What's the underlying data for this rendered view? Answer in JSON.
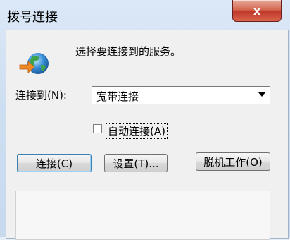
{
  "window": {
    "title": "拨号连接",
    "close_glyph": "x"
  },
  "header": {
    "prompt": "选择要连接到的服务。",
    "icon": "network-globe-icon"
  },
  "form": {
    "connect_to_label": "连接到(N):",
    "connect_to_value": "宽带连接",
    "auto_connect_label": "自动连接(A)",
    "auto_connect_checked": false
  },
  "buttons": {
    "connect": "连接(C)",
    "settings": "设置(T)...",
    "offline": "脱机工作(O)"
  },
  "colors": {
    "close_button": "#c0392b",
    "default_button_border": "#3c7fb1"
  }
}
